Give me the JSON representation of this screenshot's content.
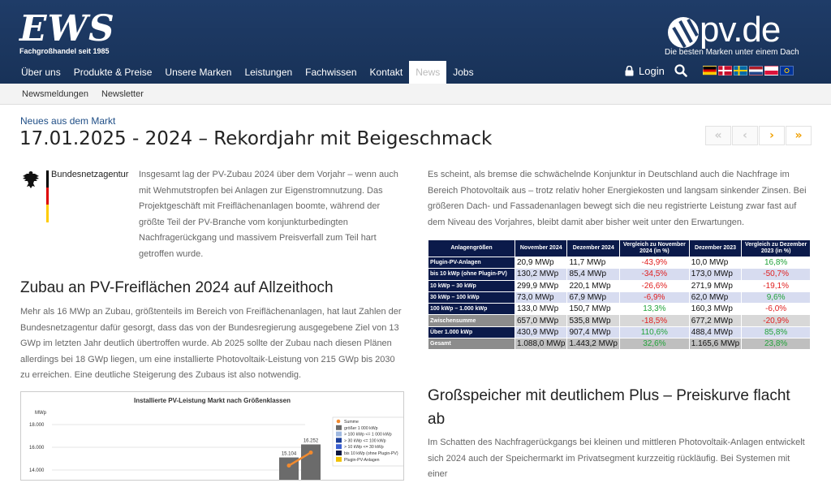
{
  "header": {
    "ews_logo": "EWS",
    "ews_tagline": "Fachgroßhandel seit 1985",
    "pv_logo": "pv.de",
    "pv_tagline": "Die besten Marken unter einem Dach",
    "nav": [
      "Über uns",
      "Produkte & Preise",
      "Unsere Marken",
      "Leistungen",
      "Fachwissen",
      "Kontakt",
      "News",
      "Jobs"
    ],
    "active_nav": "News",
    "login_label": "Login",
    "flags": [
      "de",
      "dk",
      "se",
      "nl",
      "pl",
      "eu"
    ]
  },
  "subnav": [
    "Newsmeldungen",
    "Newsletter"
  ],
  "article": {
    "kicker": "Neues aus dem Markt",
    "title": "17.01.2025 - 2024 – Rekordjahr mit Beigeschmack",
    "pager": [
      "«",
      "‹",
      "›",
      "»"
    ],
    "logo_name": "Bundesnetzagentur",
    "intro": "Insgesamt lag der PV-Zubau 2024 über dem Vorjahr – wenn auch mit Wehmutstropfen bei Anlagen zur Eigenstromnutzung. Das Projektgeschäft mit Freiflächenanlagen boomte, während der größte Teil der PV-Branche vom konjunkturbedingten Nachfragerückgang und massivem Preisverfall zum Teil hart getroffen wurde.",
    "h2_left": "Zubau an PV-Freiflächen 2024 auf Allzeithoch",
    "p_left": "Mehr als 16 MWp an Zubau, größtenteils im Bereich von Freiflächenanlagen, hat laut Zahlen der Bundesnetzagentur dafür gesorgt, dass das von der Bundesregierung ausgegebene Ziel von 13 GWp im letzten Jahr deutlich übertroffen wurde. Ab 2025 sollte der Zubau nach diesen Plänen allerdings bei 18 GWp liegen, um eine installierte Photovoltaik-Leistung von 215 GWp bis 2030 zu erreichen. Eine deutliche Steigerung des Zubaus ist also notwendig.",
    "p_right": "Es scheint, als bremse die schwächelnde Konjunktur in Deutschland auch die Nachfrage im Bereich Photovoltaik aus – trotz relativ hoher Energiekosten und langsam sinkender Zinsen. Bei größeren Dach- und Fassadenanlagen bewegt sich die neu registrierte Leistung zwar fast auf dem Niveau des Vorjahres, bleibt damit aber bisher weit unter den Erwartungen.",
    "h2_right": "Großspeicher mit deutlichem Plus – Preiskurve flacht ab",
    "p_right2": "Im Schatten des Nachfragerückgangs bei kleinen und mittleren Photovoltaik-Anlagen entwickelt sich 2024 auch der Speichermarkt im Privatsegment kurzzeitig rückläufig. Bei Systemen mit einer"
  },
  "table": {
    "headers": [
      "Anlagengrößen",
      "November 2024",
      "Dezember 2024",
      "Vergleich zu November 2024 (in %)",
      "Dezember 2023",
      "Vergleich zu Dezember 2023 (in %)"
    ],
    "rows": [
      {
        "label": "Plugin-PV-Anlagen",
        "nov": "20,9 MWp",
        "dez": "11,7 MWp",
        "vnov": "-43,9%",
        "dez23": "10,0 MWp",
        "vdez": "16,8%",
        "kind": "odd"
      },
      {
        "label": "bis 10 kWp (ohne Plugin-PV)",
        "nov": "130,2 MWp",
        "dez": "85,4 MWp",
        "vnov": "-34,5%",
        "dez23": "173,0 MWp",
        "vdez": "-50,7%",
        "kind": "even"
      },
      {
        "label": "10 kWp – 30 kWp",
        "nov": "299,9 MWp",
        "dez": "220,1 MWp",
        "vnov": "-26,6%",
        "dez23": "271,9 MWp",
        "vdez": "-19,1%",
        "kind": "odd"
      },
      {
        "label": "30 kWp – 100 kWp",
        "nov": "73,0 MWp",
        "dez": "67,9 MWp",
        "vnov": "-6,9%",
        "dez23": "62,0 MWp",
        "vdez": "9,6%",
        "kind": "even"
      },
      {
        "label": "100 kWp – 1.000 kWp",
        "nov": "133,0 MWp",
        "dez": "150,7 MWp",
        "vnov": "13,3%",
        "dez23": "160,3 MWp",
        "vdez": "-6,0%",
        "kind": "odd"
      },
      {
        "label": "Zwischensumme",
        "nov": "657,0 MWp",
        "dez": "535,8 MWp",
        "vnov": "-18,5%",
        "dez23": "677,2 MWp",
        "vdez": "-20,9%",
        "kind": "sub"
      },
      {
        "label": "Über 1.000 kWp",
        "nov": "430,9 MWp",
        "dez": "907,4 MWp",
        "vnov": "110,6%",
        "dez23": "488,4 MWp",
        "vdez": "85,8%",
        "kind": "even"
      },
      {
        "label": "Gesamt",
        "nov": "1.088,0 MWp",
        "dez": "1.443,2 MWp",
        "vnov": "32,6%",
        "dez23": "1.165,6 MWp",
        "vdez": "23,8%",
        "kind": "tot"
      }
    ]
  },
  "chart_data": {
    "type": "bar",
    "title": "Installierte PV-Leistung Markt nach Größenklassen",
    "ylabel": "MWp",
    "y_ticks": [
      "18.000",
      "16.000",
      "14.000"
    ],
    "ylim": [
      13000,
      18500
    ],
    "categories": [
      "",
      ""
    ],
    "values": [
      15104,
      16252
    ],
    "value_labels": [
      "15.104",
      "16.252"
    ],
    "line_series_name": "Summe",
    "legend": [
      "Summe",
      "größer 1 000 kWp",
      "> 100 kWp <= 1 000 kWp",
      "> 30 kWp <= 100 kWp",
      "> 10 kWp <= 30 kWp",
      "bis 10 kWp (ohne Plugin-PV)",
      "Plugin-PV-Anlagen"
    ],
    "legend_colors": [
      "#f28a2e",
      "#6b6b6b",
      "#9fb8e0",
      "#1c3f99",
      "#3a5fd0",
      "#0a1640",
      "#f0c000"
    ],
    "legend_placement": "top-right"
  }
}
